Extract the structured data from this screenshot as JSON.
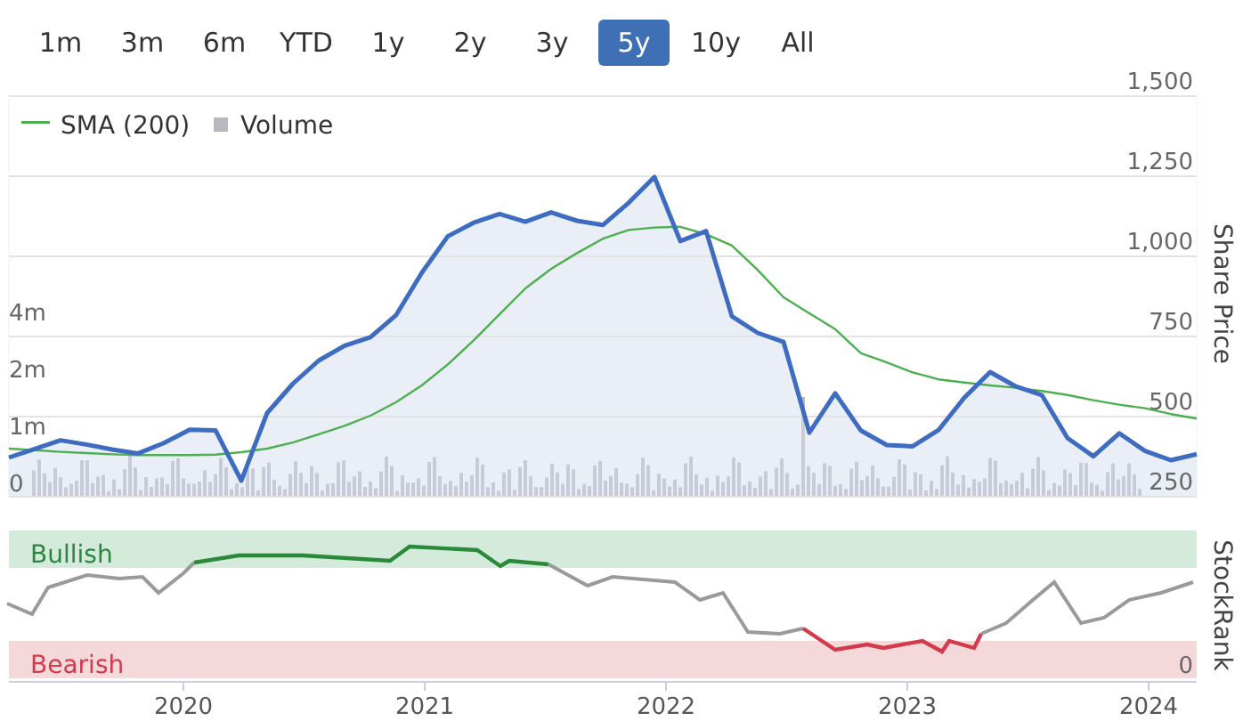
{
  "ranges": [
    {
      "label": "1m",
      "selected": false
    },
    {
      "label": "3m",
      "selected": false
    },
    {
      "label": "6m",
      "selected": false
    },
    {
      "label": "YTD",
      "selected": false
    },
    {
      "label": "1y",
      "selected": false
    },
    {
      "label": "2y",
      "selected": false
    },
    {
      "label": "3y",
      "selected": false
    },
    {
      "label": "5y",
      "selected": true
    },
    {
      "label": "10y",
      "selected": false
    },
    {
      "label": "All",
      "selected": false
    }
  ],
  "price_chart": {
    "volume_legend": {
      "label": "Volume",
      "color": "#b8b8be"
    },
    "volume_axis_labels": [
      "4m",
      "2m",
      "1m",
      "0"
    ],
    "chart_data": {
      "type": "line",
      "ylabel": "Share Price",
      "categories": [
        null,
        null,
        null,
        null,
        null,
        null,
        null,
        null,
        null,
        null,
        null,
        null,
        null,
        null,
        null,
        null,
        null,
        null,
        null,
        null,
        null,
        null,
        null,
        null,
        null,
        null,
        null,
        null,
        null,
        null,
        null,
        null,
        null,
        null,
        null,
        null,
        null,
        null,
        null,
        null,
        null,
        null,
        null,
        null,
        null,
        null,
        null
      ],
      "series": [
        {
          "color": "#3d6cc0",
          "values": [
            372,
            399,
            426,
            413,
            397,
            385,
            417,
            459,
            457,
            300,
            511,
            603,
            675,
            721,
            748,
            817,
            950,
            1063,
            1105,
            1132,
            1108,
            1137,
            1111,
            1098,
            1167,
            1248,
            1048,
            1079,
            813,
            761,
            733,
            450,
            573,
            456,
            411,
            407,
            458,
            559,
            639,
            594,
            567,
            433,
            376,
            448,
            393,
            364,
            383
          ]
        },
        {
          "name": "SMA (200)",
          "color": "#4caf50",
          "values": [
            400,
            395,
            390,
            386,
            382,
            380,
            380,
            380,
            381,
            389,
            400,
            419,
            445,
            471,
            503,
            545,
            598,
            663,
            738,
            819,
            900,
            961,
            1010,
            1055,
            1082,
            1090,
            1092,
            1069,
            1034,
            957,
            872,
            822,
            773,
            698,
            669,
            638,
            616,
            606,
            597,
            590,
            580,
            567,
            551,
            537,
            526,
            508,
            494
          ]
        }
      ],
      "ylim": [
        250,
        1500
      ],
      "grid": true,
      "yticks": [
        {
          "value": 1500,
          "label": "1,500"
        },
        {
          "value": 1250,
          "label": "1,250"
        },
        {
          "value": 1000,
          "label": "1,000"
        },
        {
          "value": 750,
          "label": "750"
        },
        {
          "value": 500,
          "label": "500"
        },
        {
          "value": 250,
          "label": "250"
        }
      ]
    }
  },
  "time_axis_labels": [
    "2020",
    "2021",
    "2022",
    "2023",
    "2024"
  ],
  "stockrank": {
    "title": "StockRank",
    "bullish_label": "Bullish",
    "bearish_label": "Bearish",
    "zero_label": "0"
  }
}
